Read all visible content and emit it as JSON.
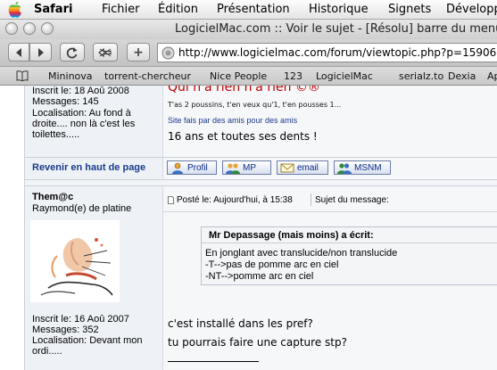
{
  "menubar": {
    "app": "Safari",
    "items": [
      "Fichier",
      "Édition",
      "Présentation",
      "Historique",
      "Signets",
      "Développ"
    ]
  },
  "window": {
    "title": "LogicielMac.com :: Voir le sujet - [Résolu] barre du menu"
  },
  "toolbar": {
    "back_icon": "back-arrow-icon",
    "forward_icon": "forward-arrow-icon",
    "reload_icon": "reload-icon",
    "snapback_icon": "snapback-icon",
    "add_bookmark_label": "+",
    "url": "http://www.logicielmac.com/forum/viewtopic.php?p=15906"
  },
  "bookmarks": {
    "items": [
      "Mininova",
      "torrent-chercheur",
      "Nice People",
      "123",
      "LogicielMac",
      "serialz.to",
      "Dexia",
      "Ap"
    ]
  },
  "post1": {
    "inscrit": "Inscrit le: 18 Aoû 2008",
    "messages": "Messages: 145",
    "localisation_lines": [
      "Localisation: Au fond à",
      "droite.... non là c'est les",
      "toilettes....."
    ],
    "sig_title": "Qui n'a rien n'a rien ©®",
    "sig_line": "T'as 2 poussins, t'en veux qu'1, t'en pousses 1...",
    "sig_sub": "Site fais par des amis pour des amis",
    "sig_text": "16 ans et toutes ses dents !"
  },
  "back_to_top": "Revenir en haut de page",
  "profile_buttons": {
    "profil": "Profil",
    "mp": "MP",
    "email": "email",
    "msnm": "MSNM"
  },
  "post2": {
    "author": "Them@c",
    "rank": "Raymond(e) de platine",
    "posted": "Posté le: Aujourd'hui, à 15:38",
    "subject": "Sujet du message:",
    "quote_author": "Mr Depassage (mais moins) a écrit:",
    "quote_lines": [
      "En jonglant avec translucide/non translucide",
      "-T-->pas de pomme arc en ciel",
      "-NT-->pomme arc en ciel"
    ],
    "inscrit": "Inscrit le: 16 Aoû 2007",
    "messages": "Messages: 352",
    "localisation_lines": [
      "Localisation: Devant mon",
      "ordi....."
    ],
    "body_lines": [
      "c'est installé dans les pref?",
      "tu pourrais faire une capture stp?"
    ]
  },
  "colors": {
    "link_blue": "#1a3c8c",
    "sig_red": "#c00000"
  }
}
